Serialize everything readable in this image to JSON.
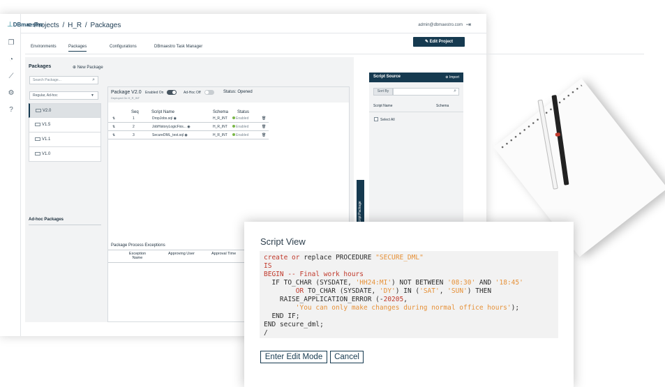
{
  "app": {
    "logo": "DBmaestro",
    "user": "admin@dbmaestro.com",
    "breadcrumb": [
      "Projects",
      "H_R",
      "Packages"
    ],
    "edit_project": "Edit Project",
    "tabs": [
      "Environments",
      "Packages",
      "Configurations",
      "DBmaestro Task Manager"
    ],
    "active_tab": "Packages"
  },
  "packages": {
    "title": "Packages",
    "new_package": "New Package",
    "search_placeholder": "Search Package...",
    "filter": "Regular, Ad-hoc",
    "items": [
      "V2.0",
      "V1.5",
      "V1.1",
      "V1.0"
    ],
    "selected": "V2.0",
    "adhoc_title": "Ad-hoc Packages"
  },
  "package_detail": {
    "name": "Package V2.0",
    "deployed": "Deployed On H_R_INT",
    "enabled_label": "Enabled On",
    "enabled": true,
    "adhoc_label": "Ad-Hoc Off",
    "adhoc": false,
    "status": "Status: Opened",
    "columns": [
      "Seq",
      "Script Name",
      "Schema",
      "Status"
    ],
    "rows": [
      {
        "seq": "1",
        "name": "DropJobs.sql",
        "schema": "H_R_INT",
        "status": "Enabled"
      },
      {
        "seq": "2",
        "name": "JobHistoryLogicFixs...",
        "schema": "H_R_INT",
        "status": "Enabled"
      },
      {
        "seq": "3",
        "name": "SecureDML_test.sql",
        "schema": "H_R_INT",
        "status": "Enabled"
      }
    ],
    "exceptions_title": "Package Process Exceptions",
    "exception_columns": [
      "Exception Name",
      "Approving User",
      "Approval Time"
    ]
  },
  "side_handle": "Script Package",
  "script_source": {
    "title": "Script Source",
    "import": "Import",
    "sort_by": "Sort By",
    "columns": [
      "Script Name",
      "Schema"
    ],
    "select_all": "Select All"
  },
  "dialog": {
    "title": "Script View",
    "code_lines": [
      [
        {
          "t": "create or",
          "c": "kw"
        },
        {
          "t": " replace PROCEDURE "
        },
        {
          "t": "\"SECURE_DML\"",
          "c": "str"
        }
      ],
      [
        {
          "t": "IS",
          "c": "kw"
        }
      ],
      [
        {
          "t": "BEGIN",
          "c": "kw"
        },
        {
          "t": " -- Final work hours",
          "c": "cm"
        }
      ],
      [
        {
          "t": "  IF TO_CHAR (SYSDATE, "
        },
        {
          "t": "'HH24:MI'",
          "c": "str"
        },
        {
          "t": ") NOT BETWEEN "
        },
        {
          "t": "'08:30'",
          "c": "str"
        },
        {
          "t": " AND "
        },
        {
          "t": "'18:45'",
          "c": "str"
        }
      ],
      [
        {
          "t": "        "
        },
        {
          "t": "OR",
          "c": "kw"
        },
        {
          "t": " TO_CHAR (SYSDATE, "
        },
        {
          "t": "'DY'",
          "c": "str"
        },
        {
          "t": ") IN ("
        },
        {
          "t": "'SAT'",
          "c": "str"
        },
        {
          "t": ", "
        },
        {
          "t": "'SUN'",
          "c": "str"
        },
        {
          "t": ") THEN"
        }
      ],
      [
        {
          "t": "    RAISE_APPLICATION_ERROR (-"
        },
        {
          "t": "20205",
          "c": "kw"
        },
        {
          "t": ","
        }
      ],
      [
        {
          "t": "        "
        },
        {
          "t": "'You can only make changes during normal office hours'",
          "c": "str"
        },
        {
          "t": ");"
        }
      ],
      [
        {
          "t": "  END IF;"
        }
      ],
      [
        {
          "t": "END secure_dml;"
        }
      ],
      [
        {
          "t": "/"
        }
      ]
    ],
    "edit_button": "Enter Edit Mode",
    "cancel_button": "Cancel"
  }
}
